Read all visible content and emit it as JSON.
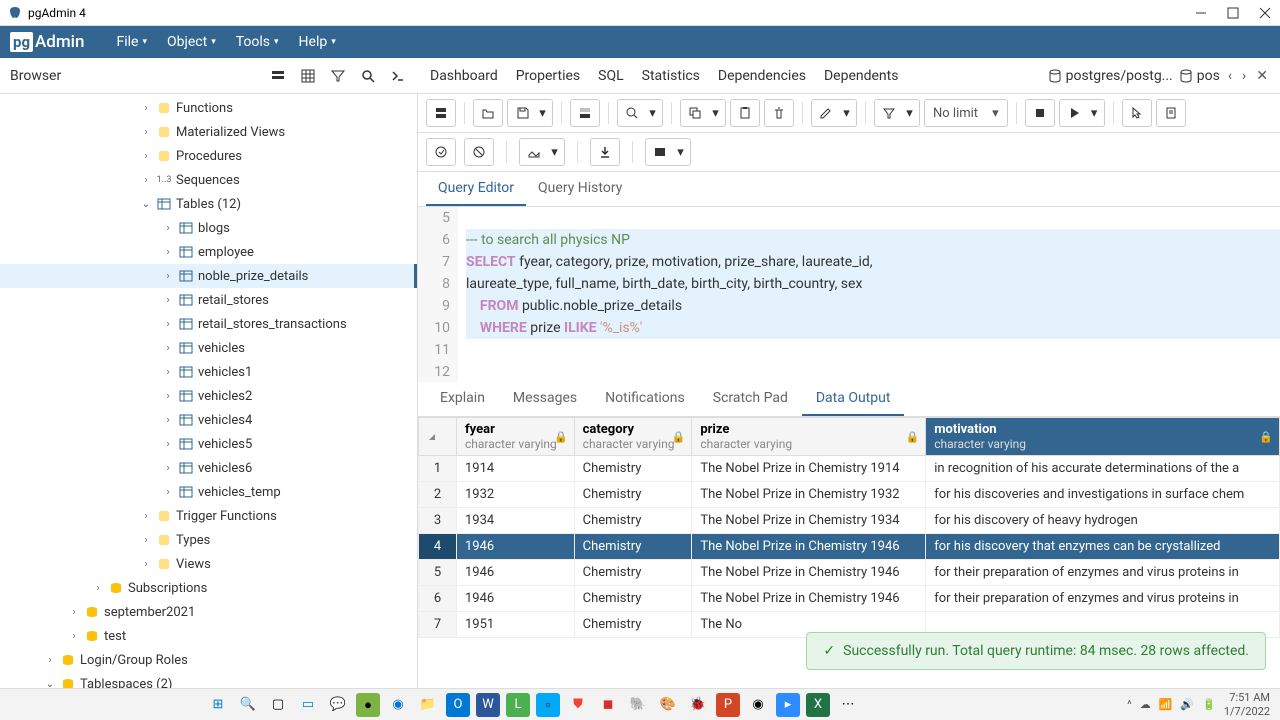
{
  "titlebar": {
    "title": "pgAdmin 4"
  },
  "menubar": {
    "logo": "Admin",
    "items": [
      "File",
      "Object",
      "Tools",
      "Help"
    ]
  },
  "browser_label": "Browser",
  "top_tabs": [
    "Dashboard",
    "Properties",
    "SQL",
    "Statistics",
    "Dependencies",
    "Dependents"
  ],
  "connection": {
    "db": "postgres/postg...",
    "pos": "pos"
  },
  "tree": [
    {
      "indent": 140,
      "chevron": "›",
      "icon": "func",
      "label": "Functions"
    },
    {
      "indent": 140,
      "chevron": "›",
      "icon": "func",
      "label": "Materialized Views"
    },
    {
      "indent": 140,
      "chevron": "›",
      "icon": "func",
      "label": "Procedures"
    },
    {
      "indent": 140,
      "chevron": "›",
      "icon": "gen",
      "label": "Sequences",
      "iconText": "1..3"
    },
    {
      "indent": 140,
      "chevron": "⌄",
      "icon": "table",
      "label": "Tables (12)"
    },
    {
      "indent": 162,
      "chevron": "›",
      "icon": "table",
      "label": "blogs"
    },
    {
      "indent": 162,
      "chevron": "›",
      "icon": "table",
      "label": "employee"
    },
    {
      "indent": 162,
      "chevron": "›",
      "icon": "table",
      "label": "noble_prize_details",
      "selected": true
    },
    {
      "indent": 162,
      "chevron": "›",
      "icon": "table",
      "label": "retail_stores"
    },
    {
      "indent": 162,
      "chevron": "›",
      "icon": "table",
      "label": "retail_stores_transactions"
    },
    {
      "indent": 162,
      "chevron": "›",
      "icon": "table",
      "label": "vehicles"
    },
    {
      "indent": 162,
      "chevron": "›",
      "icon": "table",
      "label": "vehicles1"
    },
    {
      "indent": 162,
      "chevron": "›",
      "icon": "table",
      "label": "vehicles2"
    },
    {
      "indent": 162,
      "chevron": "›",
      "icon": "table",
      "label": "vehicles4"
    },
    {
      "indent": 162,
      "chevron": "›",
      "icon": "table",
      "label": "vehicles5"
    },
    {
      "indent": 162,
      "chevron": "›",
      "icon": "table",
      "label": "vehicles6"
    },
    {
      "indent": 162,
      "chevron": "›",
      "icon": "table",
      "label": "vehicles_temp"
    },
    {
      "indent": 140,
      "chevron": "›",
      "icon": "func",
      "label": "Trigger Functions"
    },
    {
      "indent": 140,
      "chevron": "›",
      "icon": "func",
      "label": "Types"
    },
    {
      "indent": 140,
      "chevron": "›",
      "icon": "func",
      "label": "Views"
    },
    {
      "indent": 92,
      "chevron": "›",
      "icon": "db",
      "label": "Subscriptions"
    },
    {
      "indent": 68,
      "chevron": "›",
      "icon": "db",
      "label": "september2021"
    },
    {
      "indent": 68,
      "chevron": "›",
      "icon": "db",
      "label": "test"
    },
    {
      "indent": 44,
      "chevron": "›",
      "icon": "db",
      "label": "Login/Group Roles"
    },
    {
      "indent": 44,
      "chevron": "⌄",
      "icon": "db",
      "label": "Tablespaces (2)"
    }
  ],
  "editor_tabs": [
    "Query Editor",
    "Query History"
  ],
  "code_lines": [
    {
      "num": 5,
      "html": ""
    },
    {
      "num": 6,
      "html": "<span class='cm'>--- to search all physics NP</span>",
      "hl": true
    },
    {
      "num": 7,
      "html": "<span class='kw'>SELECT</span> <span class='id'>fyear, category, prize, motivation, prize_share, laureate_id,</span>",
      "hl": true
    },
    {
      "num": 8,
      "html": "<span class='id'>laureate_type, full_name, birth_date, birth_city, birth_country, sex</span>",
      "hl": true
    },
    {
      "num": 9,
      "html": "    <span class='kw'>FROM</span> <span class='id'>public.noble_prize_details</span>",
      "hl": true
    },
    {
      "num": 10,
      "html": "    <span class='kw'>WHERE</span> <span class='id'>prize</span> <span class='kw'>ILIKE</span> <span class='str'>'%_is%'</span>",
      "hl": true
    },
    {
      "num": 11,
      "html": ""
    },
    {
      "num": 12,
      "html": ""
    }
  ],
  "result_tabs": [
    "Explain",
    "Messages",
    "Notifications",
    "Scratch Pad",
    "Data Output"
  ],
  "columns": [
    {
      "name": "fyear",
      "type": "character varying"
    },
    {
      "name": "category",
      "type": "character varying"
    },
    {
      "name": "prize",
      "type": "character varying"
    },
    {
      "name": "motivation",
      "type": "character varying",
      "selected": true
    }
  ],
  "rows": [
    {
      "n": 1,
      "fyear": "1914",
      "category": "Chemistry",
      "prize": "The Nobel Prize in Chemistry 1914",
      "motivation": "in recognition of his accurate determinations of the a"
    },
    {
      "n": 2,
      "fyear": "1932",
      "category": "Chemistry",
      "prize": "The Nobel Prize in Chemistry 1932",
      "motivation": "for his discoveries and investigations in surface chem"
    },
    {
      "n": 3,
      "fyear": "1934",
      "category": "Chemistry",
      "prize": "The Nobel Prize in Chemistry 1934",
      "motivation": "for his discovery of heavy hydrogen"
    },
    {
      "n": 4,
      "fyear": "1946",
      "category": "Chemistry",
      "prize": "The Nobel Prize in Chemistry 1946",
      "motivation": "for his discovery that enzymes can be crystallized",
      "selected": true
    },
    {
      "n": 5,
      "fyear": "1946",
      "category": "Chemistry",
      "prize": "The Nobel Prize in Chemistry 1946",
      "motivation": "for their preparation of enzymes and virus proteins in"
    },
    {
      "n": 6,
      "fyear": "1946",
      "category": "Chemistry",
      "prize": "The Nobel Prize in Chemistry 1946",
      "motivation": "for their preparation of enzymes and virus proteins in"
    },
    {
      "n": 7,
      "fyear": "1951",
      "category": "Chemistry",
      "prize": "The No",
      "motivation": ""
    }
  ],
  "toast": "Successfully run. Total query runtime: 84 msec. 28 rows affected.",
  "limit_label": "No limit",
  "clock": {
    "time": "7:51 AM",
    "date": "1/7/2022"
  }
}
